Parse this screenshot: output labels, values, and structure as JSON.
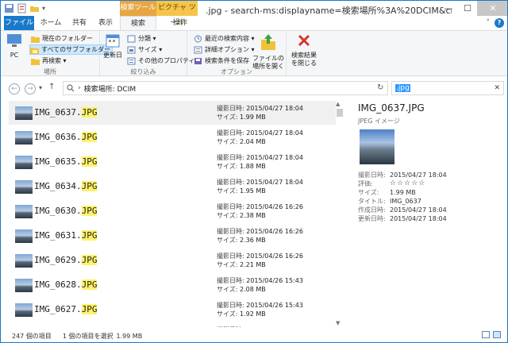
{
  "window": {
    "title": ".jpg - search-ms:displayname=検索場所%3A%20DCIM&crumb...",
    "context_search": "検索ツール",
    "context_picture": "ピクチャ ツール",
    "min": "—",
    "max": "☐",
    "close": "✕"
  },
  "tabs": {
    "file": "ファイル",
    "home": "ホーム",
    "share": "共有",
    "view": "表示",
    "search": "検索",
    "ops": "操作"
  },
  "ribbon": {
    "location": {
      "pc": "PC",
      "current_folder": "現在のフォルダー",
      "all_subfolders": "すべてのサブフォルダー",
      "search_again": "再検索 ▾",
      "label": "場所"
    },
    "refine": {
      "date_modified": "更新日",
      "kind": "分類 ▾",
      "size": "サイズ ▾",
      "other_props": "その他のプロパティ ▾",
      "label": "絞り込み"
    },
    "options": {
      "recent": "最近の検索内容 ▾",
      "advanced": "詳細オプション ▾",
      "save_search": "検索条件を保存",
      "open_location_1": "ファイルの",
      "open_location_2": "場所を開く",
      "label": "オプション"
    },
    "close": {
      "line1": "検索結果",
      "line2": "を閉じる"
    }
  },
  "address": {
    "path": "検索場所: DCIM",
    "search_query": ".jpg",
    "back": "←",
    "forward": "→",
    "up": "↑"
  },
  "files": [
    {
      "base": "IMG_0637.",
      "ext": "JPG",
      "date_label": "撮影日時:",
      "date": "2015/04/27 18:04",
      "size_label": "サイズ:",
      "size": "1.99 MB"
    },
    {
      "base": "IMG_0636.",
      "ext": "JPG",
      "date_label": "撮影日時:",
      "date": "2015/04/27 18:04",
      "size_label": "サイズ:",
      "size": "2.04 MB"
    },
    {
      "base": "IMG_0635.",
      "ext": "JPG",
      "date_label": "撮影日時:",
      "date": "2015/04/27 18:04",
      "size_label": "サイズ:",
      "size": "1.88 MB"
    },
    {
      "base": "IMG_0634.",
      "ext": "JPG",
      "date_label": "撮影日時:",
      "date": "2015/04/27 18:04",
      "size_label": "サイズ:",
      "size": "1.95 MB"
    },
    {
      "base": "IMG_0630.",
      "ext": "JPG",
      "date_label": "撮影日時:",
      "date": "2015/04/26 16:26",
      "size_label": "サイズ:",
      "size": "2.38 MB"
    },
    {
      "base": "IMG_0631.",
      "ext": "JPG",
      "date_label": "撮影日時:",
      "date": "2015/04/26 16:26",
      "size_label": "サイズ:",
      "size": "2.36 MB"
    },
    {
      "base": "IMG_0629.",
      "ext": "JPG",
      "date_label": "撮影日時:",
      "date": "2015/04/26 16:26",
      "size_label": "サイズ:",
      "size": "2.21 MB"
    },
    {
      "base": "IMG_0628.",
      "ext": "JPG",
      "date_label": "撮影日時:",
      "date": "2015/04/26 15:43",
      "size_label": "サイズ:",
      "size": "2.08 MB"
    },
    {
      "base": "IMG_0627.",
      "ext": "JPG",
      "date_label": "撮影日時:",
      "date": "2015/04/26 15:43",
      "size_label": "サイズ:",
      "size": "1.92 MB"
    },
    {
      "base": "IMG_0626.",
      "ext": "JPG",
      "date_label": "撮影日時:",
      "date": "",
      "size_label": "",
      "size": ""
    }
  ],
  "details": {
    "title": "IMG_0637.JPG",
    "type": "JPEG イメージ",
    "props": [
      {
        "k": "撮影日時:",
        "v": "2015/04/27 18:04"
      },
      {
        "k": "評価:",
        "v": "☆☆☆☆☆"
      },
      {
        "k": "サイズ:",
        "v": "1.99 MB"
      },
      {
        "k": "タイトル:",
        "v": "IMG_0637"
      },
      {
        "k": "作成日時:",
        "v": "2015/04/27 18:04"
      },
      {
        "k": "更新日時:",
        "v": "2015/04/27 18:04"
      }
    ]
  },
  "status": {
    "count": "247 個の項目",
    "selected": "1 個の項目を選択",
    "selected_size": "1.99 MB"
  },
  "colors": {
    "accent": "#1979ca",
    "highlight": "#fff26a",
    "selection": "#cce8ff"
  }
}
